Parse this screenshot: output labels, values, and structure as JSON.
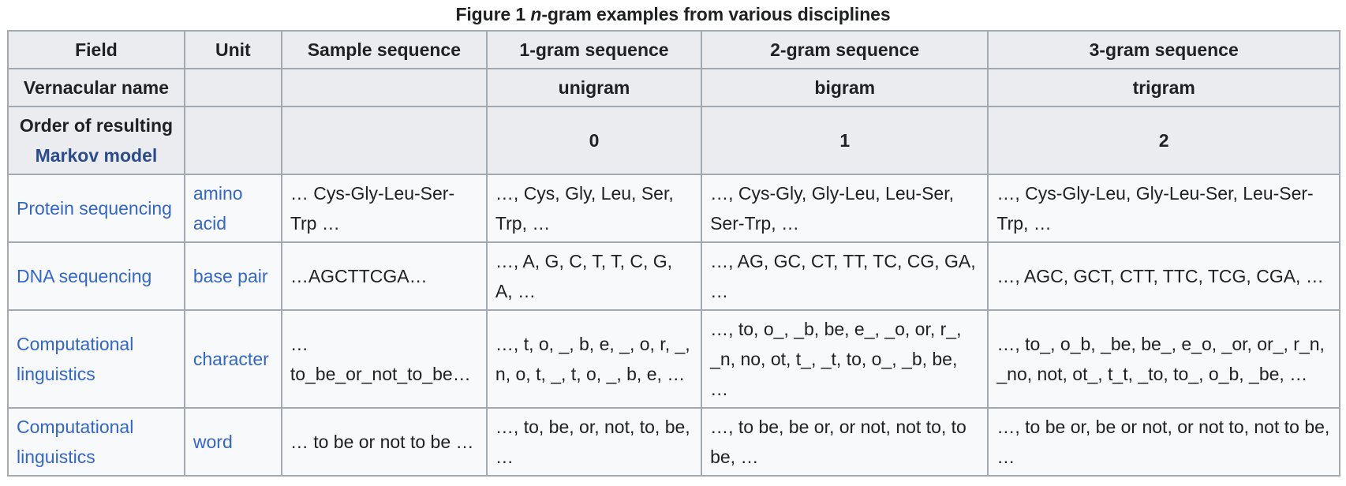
{
  "caption": {
    "prefix": "Figure 1 ",
    "italic": "n",
    "suffix": "-gram examples from various disciplines"
  },
  "header": {
    "row1": [
      "Field",
      "Unit",
      "Sample sequence",
      "1-gram sequence",
      "2-gram sequence",
      "3-gram sequence"
    ],
    "row2": {
      "label": "Vernacular name",
      "unit": "",
      "sample": "",
      "g1": "unigram",
      "g2": "bigram",
      "g3": "trigram"
    },
    "row3": {
      "label_text": "Order of resulting",
      "label_link": "Markov model",
      "unit": "",
      "sample": "",
      "g1": "0",
      "g2": "1",
      "g3": "2"
    }
  },
  "rows": [
    {
      "field": "Protein sequencing",
      "unit": "amino acid",
      "sample": "… Cys-Gly-Leu-Ser-Trp …",
      "g1": "…, Cys, Gly, Leu, Ser, Trp, …",
      "g2": "…, Cys-Gly, Gly-Leu, Leu-Ser, Ser-Trp, …",
      "g3": "…, Cys-Gly-Leu, Gly-Leu-Ser, Leu-Ser-Trp, …"
    },
    {
      "field": "DNA sequencing",
      "unit": "base pair",
      "sample": "…AGCTTCGA…",
      "g1": "…, A, G, C, T, T, C, G, A, …",
      "g2": "…, AG, GC, CT, TT, TC, CG, GA, …",
      "g3": "…, AGC, GCT, CTT, TTC, TCG, CGA, …"
    },
    {
      "field": "Computational linguistics",
      "unit": "character",
      "sample": "…to_be_or_not_to_be…",
      "g1": "…, t, o, _, b, e, _, o, r, _, n, o, t, _, t, o, _, b, e, …",
      "g2": "…, to, o_, _b, be, e_, _o, or, r_, _n, no, ot, t_, _t, to, o_, _b, be, …",
      "g3": "…, to_, o_b, _be, be_, e_o, _or, or_, r_n, _no, not, ot_, t_t, _to, to_, o_b, _be, …"
    },
    {
      "field": "Computational linguistics",
      "unit": "word",
      "sample": "… to be or not to be …",
      "g1": "…, to, be, or, not, to, be, …",
      "g2": "…, to be, be or, or not, not to, to be, …",
      "g3": "…, to be or, be or not, or not to, not to be, …"
    }
  ]
}
